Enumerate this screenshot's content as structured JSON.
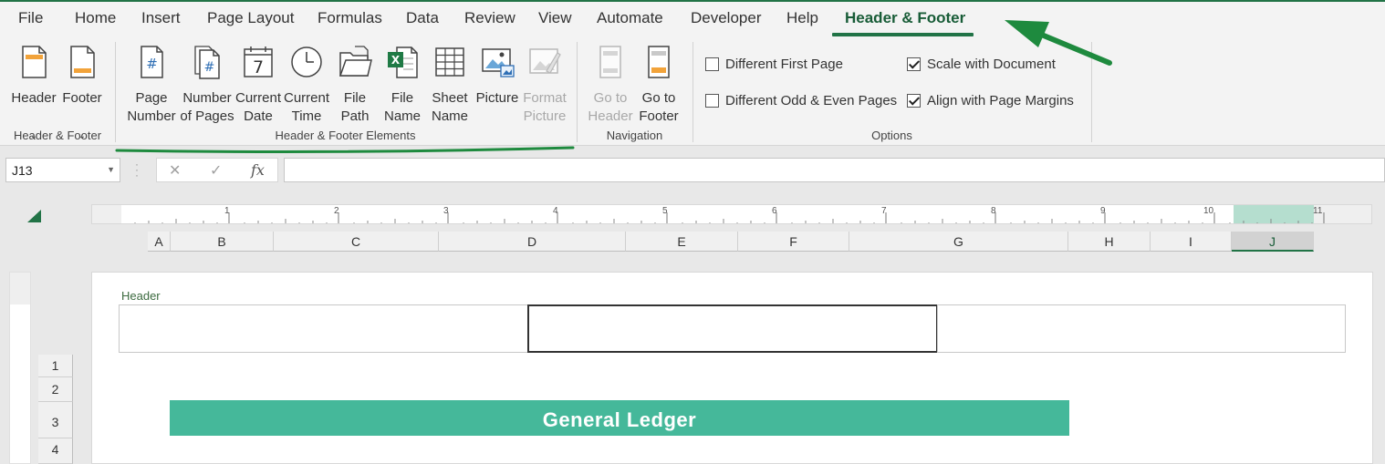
{
  "tabs": [
    "File",
    "Home",
    "Insert",
    "Page Layout",
    "Formulas",
    "Data",
    "Review",
    "View",
    "Automate",
    "Developer",
    "Help",
    "Header & Footer"
  ],
  "active_tab": "Header & Footer",
  "ribbon": {
    "header_footer_group": {
      "label": "Header & Footer",
      "header_button": "Header",
      "footer_button": "Footer"
    },
    "elements_group": {
      "label": "Header & Footer Elements",
      "page_number": "Page\nNumber",
      "number_of_pages": "Number\nof Pages",
      "current_date": "Current\nDate",
      "current_time": "Current\nTime",
      "file_path": "File\nPath",
      "file_name": "File\nName",
      "sheet_name": "Sheet\nName",
      "picture": "Picture",
      "format_picture": "Format\nPicture"
    },
    "navigation_group": {
      "label": "Navigation",
      "go_to_header": "Go to\nHeader",
      "go_to_footer": "Go to\nFooter"
    },
    "options_group": {
      "label": "Options",
      "different_first_page": {
        "label": "Different First Page",
        "checked": false
      },
      "different_odd_even": {
        "label": "Different Odd & Even Pages",
        "checked": false
      },
      "scale_with_document": {
        "label": "Scale with Document",
        "checked": true
      },
      "align_with_margins": {
        "label": "Align with Page Margins",
        "checked": true
      }
    }
  },
  "formula_bar": {
    "name_box": "J13",
    "cancel_icon": "✕",
    "enter_icon": "✓",
    "fx_label": "fx",
    "formula": ""
  },
  "ruler": {
    "numbers": [
      "1",
      "2",
      "3",
      "4",
      "5",
      "6",
      "7",
      "8",
      "9",
      "10",
      "11"
    ]
  },
  "columns": [
    "A",
    "B",
    "C",
    "D",
    "E",
    "F",
    "G",
    "H",
    "I",
    "J"
  ],
  "selected_column": "J",
  "rows": [
    "1",
    "2",
    "3",
    "4"
  ],
  "page": {
    "header_label": "Header",
    "banner_title": "General Ledger"
  },
  "colors": {
    "excel_green": "#217346",
    "banner_teal": "#45b89a",
    "annotation_green": "#1e8a3e"
  }
}
